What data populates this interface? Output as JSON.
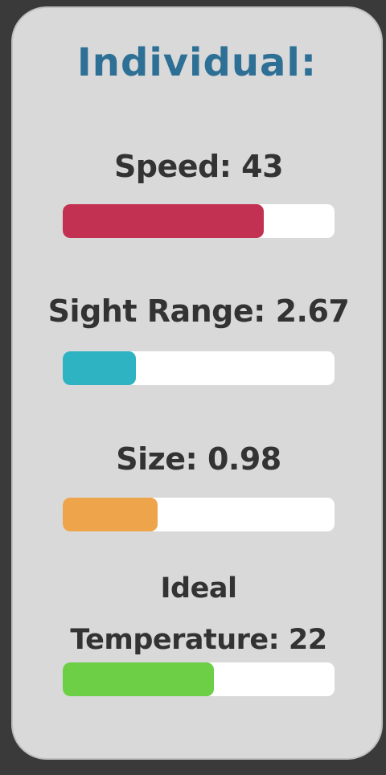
{
  "panel": {
    "title": "Individual:"
  },
  "stats": [
    {
      "label": "Speed: 43",
      "fill_fraction": 0.74,
      "color": "#c23152"
    },
    {
      "label": "Sight Range: 2.67",
      "fill_fraction": 0.27,
      "color": "#2eb3c2"
    },
    {
      "label": "Size: 0.98",
      "fill_fraction": 0.35,
      "color": "#eea44a"
    },
    {
      "label": "Ideal Temperature: 22",
      "label_lines": [
        "Ideal",
        "Temperature: 22"
      ],
      "fill_fraction": 0.555,
      "color": "#6ccf46"
    }
  ]
}
